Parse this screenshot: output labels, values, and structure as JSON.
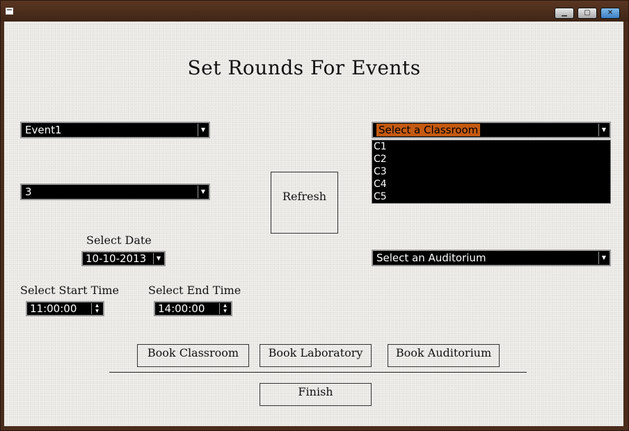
{
  "window": {
    "minimize_glyph": "▁",
    "maximize_glyph": "▢",
    "close_glyph": "✕"
  },
  "form": {
    "title": "Set Rounds For Events",
    "event_combo": {
      "value": "Event1"
    },
    "round_combo": {
      "value": "3"
    },
    "refresh_button": "Refresh",
    "classroom_combo": {
      "value": "Select a Classroom"
    },
    "classroom_list": [
      "C1",
      "C2",
      "C3",
      "C4",
      "C5"
    ],
    "auditorium_combo": {
      "value": "Select an Auditorium"
    },
    "date": {
      "label": "Select Date",
      "value": "10-10-2013"
    },
    "start_time": {
      "label": "Select Start Time",
      "value": "11:00:00"
    },
    "end_time": {
      "label": "Select End Time",
      "value": "14:00:00"
    },
    "book_classroom": "Book Classroom",
    "book_laboratory": "Book Laboratory",
    "book_auditorium": "Book Auditorium",
    "finish": "Finish"
  },
  "icons": {
    "dropdown": "▼",
    "spin_up": "▲",
    "spin_down": "▼"
  },
  "colors": {
    "frame": "#4a2c1c",
    "control_bg": "#000000",
    "selection": "#c55a11"
  }
}
